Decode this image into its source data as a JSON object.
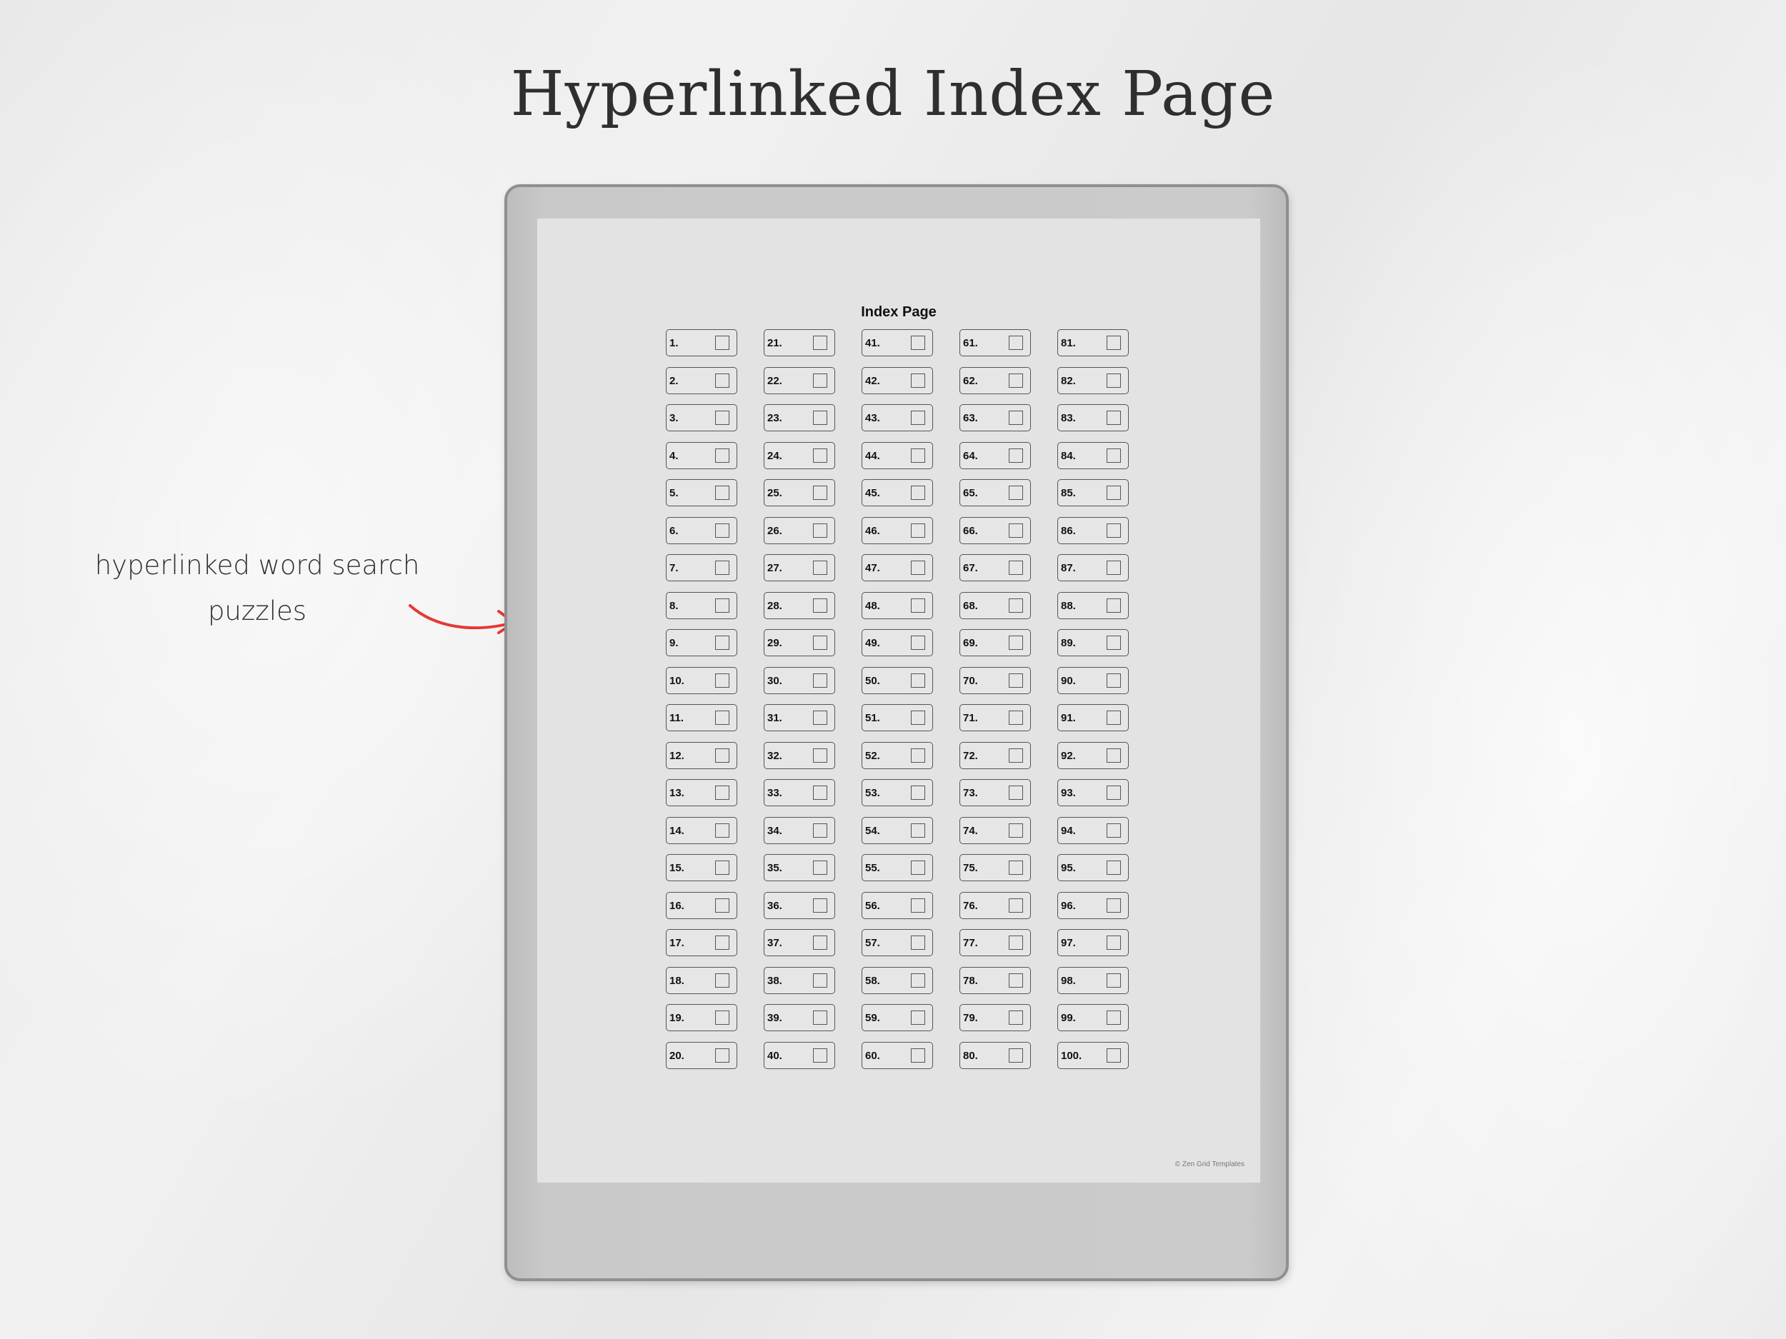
{
  "page": {
    "title": "Hyperlinked Index Page",
    "callout_line1": "hyperlinked word search",
    "callout_line2": "puzzles",
    "arrow_color": "#e53935"
  },
  "document": {
    "title": "Index Page",
    "footer": "© Zen Grid Templates",
    "columns": [
      [
        "1.",
        "2.",
        "3.",
        "4.",
        "5.",
        "6.",
        "7.",
        "8.",
        "9.",
        "10.",
        "11.",
        "12.",
        "13.",
        "14.",
        "15.",
        "16.",
        "17.",
        "18.",
        "19.",
        "20."
      ],
      [
        "21.",
        "22.",
        "23.",
        "24.",
        "25.",
        "26.",
        "27.",
        "28.",
        "29.",
        "30.",
        "31.",
        "32.",
        "33.",
        "34.",
        "35.",
        "36.",
        "37.",
        "38.",
        "39.",
        "40."
      ],
      [
        "41.",
        "42.",
        "43.",
        "44.",
        "45.",
        "46.",
        "47.",
        "48.",
        "49.",
        "50.",
        "51.",
        "52.",
        "53.",
        "54.",
        "55.",
        "56.",
        "57.",
        "58.",
        "59.",
        "60."
      ],
      [
        "61.",
        "62.",
        "63.",
        "64.",
        "65.",
        "66.",
        "67.",
        "68.",
        "69.",
        "70.",
        "71.",
        "72.",
        "73.",
        "74.",
        "75.",
        "76.",
        "77.",
        "78.",
        "79.",
        "80."
      ],
      [
        "81.",
        "82.",
        "83.",
        "84.",
        "85.",
        "86.",
        "87.",
        "88.",
        "89.",
        "90.",
        "91.",
        "92.",
        "93.",
        "94.",
        "95.",
        "96.",
        "97.",
        "98.",
        "99.",
        "100."
      ]
    ]
  }
}
